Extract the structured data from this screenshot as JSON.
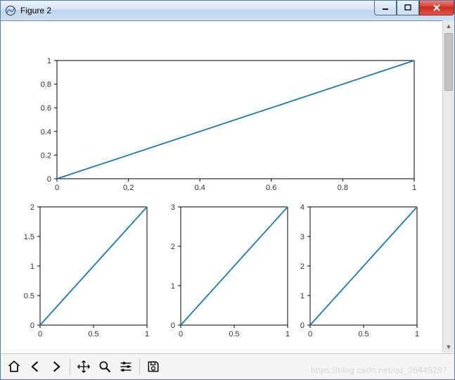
{
  "window": {
    "title": "Figure 2",
    "buttons": {
      "minimize": "Minimize",
      "maximize": "Maximize",
      "close": "Close"
    }
  },
  "toolbar": {
    "home": "Home",
    "back": "Back",
    "forward": "Forward",
    "pan": "Pan",
    "zoom": "Zoom",
    "configure": "Configure subplots",
    "save": "Save"
  },
  "watermark": "https://blog.csdn.net/qq_26449287",
  "colors": {
    "line": "#1f77b4"
  },
  "chart_data": [
    {
      "type": "line",
      "title": "",
      "xlabel": "",
      "ylabel": "",
      "x": [
        0.0,
        1.0
      ],
      "y": [
        0.0,
        1.0
      ],
      "xlim": [
        0.0,
        1.0
      ],
      "ylim": [
        0.0,
        1.0
      ],
      "xticks": [
        0.0,
        0.2,
        0.4,
        0.6,
        0.8,
        1.0
      ],
      "yticks": [
        0.0,
        0.2,
        0.4,
        0.6,
        0.8,
        1.0
      ]
    },
    {
      "type": "line",
      "title": "",
      "xlabel": "",
      "ylabel": "",
      "x": [
        0.0,
        1.0
      ],
      "y": [
        0.0,
        2.0
      ],
      "xlim": [
        0.0,
        1.0
      ],
      "ylim": [
        0.0,
        2.0
      ],
      "xticks": [
        0.0,
        0.5,
        1.0
      ],
      "yticks": [
        0.0,
        0.5,
        1.0,
        1.5,
        2.0
      ]
    },
    {
      "type": "line",
      "title": "",
      "xlabel": "",
      "ylabel": "",
      "x": [
        0.0,
        1.0
      ],
      "y": [
        0.0,
        3.0
      ],
      "xlim": [
        0.0,
        1.0
      ],
      "ylim": [
        0.0,
        3.0
      ],
      "xticks": [
        0.0,
        0.5,
        1.0
      ],
      "yticks": [
        0,
        1,
        2,
        3
      ]
    },
    {
      "type": "line",
      "title": "",
      "xlabel": "",
      "ylabel": "",
      "x": [
        0.0,
        1.0
      ],
      "y": [
        0.0,
        4.0
      ],
      "xlim": [
        0.0,
        1.0
      ],
      "ylim": [
        0.0,
        4.0
      ],
      "xticks": [
        0.0,
        0.5,
        1.0
      ],
      "yticks": [
        0,
        1,
        2,
        3,
        4
      ]
    }
  ]
}
